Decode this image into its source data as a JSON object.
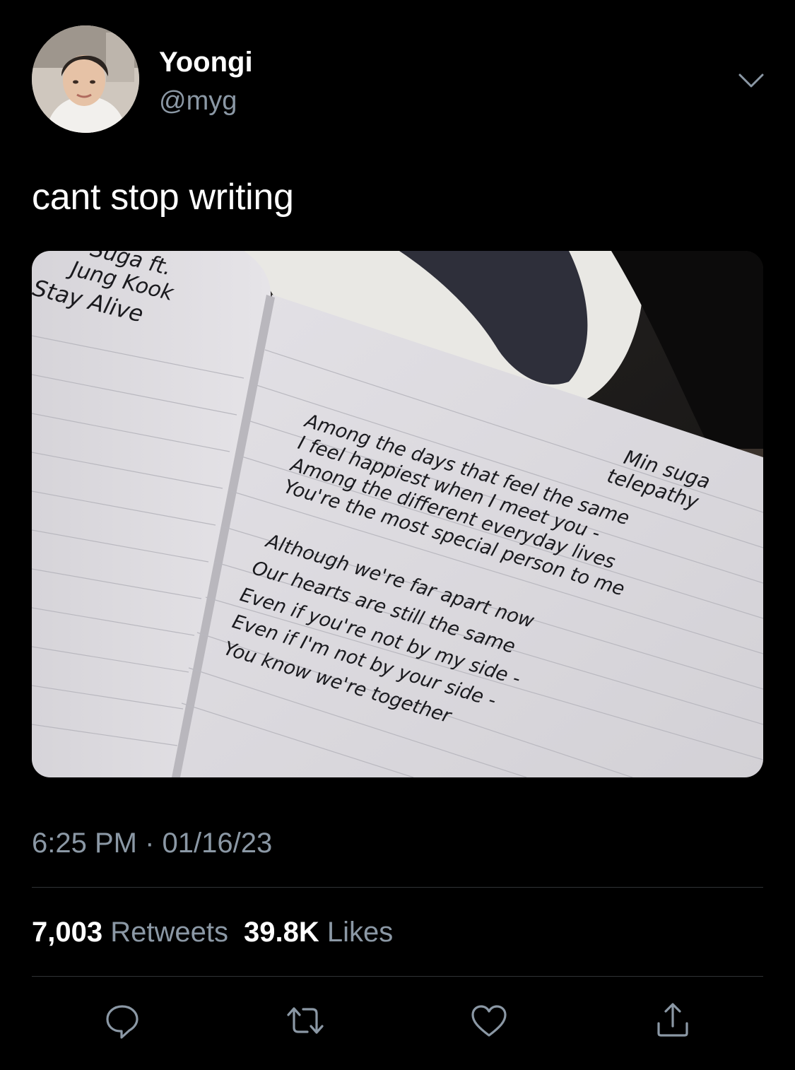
{
  "tweet": {
    "author": {
      "display_name": "Yoongi",
      "handle": "@myg"
    },
    "text": "cant stop writing",
    "image": {
      "left_page": {
        "lines": [
          "Suga ft.",
          "Jung Kook",
          "Stay Alive"
        ]
      },
      "right_page": {
        "heading": [
          "Min suga",
          "telepathy"
        ],
        "lines": [
          "Among the days that feel the same",
          "I feel happiest when I meet you -",
          "Among the different everyday lives",
          "You're the most special person to me",
          "Although we're far apart now",
          "Our hearts are still the same",
          "Even if you're not by my side -",
          "Even if I'm not by your side -",
          "You know we're together"
        ]
      }
    },
    "time": "6:25 PM",
    "separator": "·",
    "date": "01/16/23",
    "stats": {
      "retweets_count": "7,003",
      "retweets_label": "Retweets",
      "likes_count": "39.8K",
      "likes_label": "Likes"
    },
    "actions": [
      "reply-icon",
      "retweet-icon",
      "like-icon",
      "share-icon"
    ]
  },
  "colors": {
    "background": "#000000",
    "primary_text": "#ffffff",
    "secondary_text": "#8b98a5",
    "divider": "#2f3336",
    "icon": "#8b98a5"
  }
}
